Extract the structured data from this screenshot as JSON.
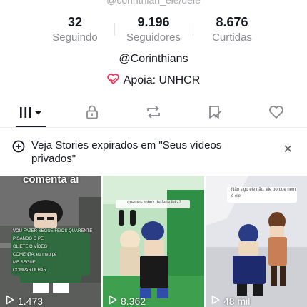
{
  "handle_top": "@corinthian_ele/dele",
  "stats": [
    {
      "value": "32",
      "label": "Seguindo"
    },
    {
      "value": "9.196",
      "label": "Seguidores"
    },
    {
      "value": "8.676",
      "label": "Curtidas"
    }
  ],
  "bio_link": "@Corinthians",
  "support_text": "Apoia: UNHCR",
  "tab_icons": [
    "grid-icon",
    "lock-icon",
    "repost-icon",
    "bookmark-icon",
    "liked-icon"
  ],
  "notice": {
    "text": "Veja Stories expirados em \"Seus vídeos privados\"",
    "close": "✕"
  },
  "videos": [
    {
      "views": "1.473",
      "caption": "comenta aí",
      "overlay_lines": [
        "VOU FAZER SEGUE FEIOS QUARENTE",
        "PISANDO O PÉ",
        "OLIETE O VÍDEO",
        "COMENTA: eu meu pé",
        "ME SEGUE",
        "COMPARTILHAR"
      ]
    },
    {
      "views": "8.362",
      "bubble": "quantos robux de feria feliz?"
    },
    {
      "views": "48 mil",
      "bubble": "Não sigo ele não, ele porque nem é ele"
    }
  ],
  "colors": {
    "heart_pink": "#fe2c55",
    "text_dark": "#161823",
    "text_grey": "#8a8b91"
  }
}
